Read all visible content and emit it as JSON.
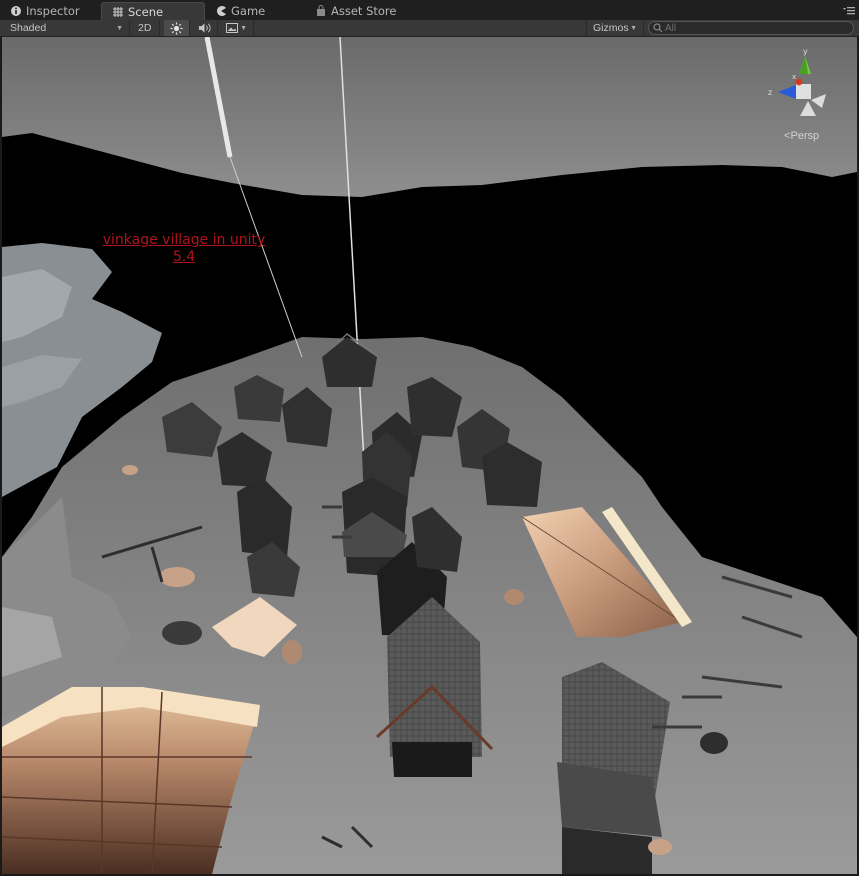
{
  "tabs": {
    "inspector": "Inspector",
    "scene": "Scene",
    "game": "Game",
    "asset_store": "Asset Store"
  },
  "toolbar": {
    "render_mode": "Shaded",
    "mode_2d": "2D",
    "gizmos": "Gizmos",
    "search_placeholder": "All"
  },
  "scene": {
    "annotation_line1": "vinkage village in unity",
    "annotation_line2": "5.4",
    "view_mode": "Persp"
  },
  "gizmo": {
    "axis_y": "y",
    "axis_x": "x",
    "axis_z": "z"
  },
  "icons": [
    "info-icon",
    "scene-grid-icon",
    "game-pacman-icon",
    "store-bag-icon",
    "sun-icon",
    "audio-icon",
    "image-icon",
    "menu-icon",
    "search-icon"
  ]
}
